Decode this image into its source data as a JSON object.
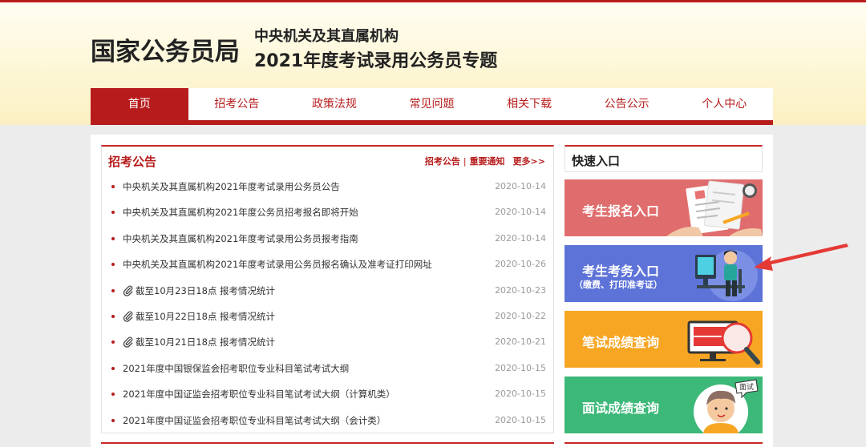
{
  "header": {
    "logo": "国家公务员局",
    "subtitle_line1": "中央机关及其直属机构",
    "subtitle_line2": "2021年度考试录用公务员专题"
  },
  "nav": {
    "items": [
      {
        "label": "首页",
        "active": true
      },
      {
        "label": "招考公告"
      },
      {
        "label": "政策法规"
      },
      {
        "label": "常见问题"
      },
      {
        "label": "相关下载"
      },
      {
        "label": "公告公示"
      },
      {
        "label": "个人中心"
      }
    ]
  },
  "notices": {
    "title": "招考公告",
    "link_notices": "招考公告",
    "separator": "|",
    "link_important": "重要通知",
    "link_more": "更多>>",
    "items": [
      {
        "text": "中央机关及其直属机构2021年度考试录用公务员公告",
        "date": "2020-10-14"
      },
      {
        "text": "中央机关及其直属机构2021年度公务员招考报名即将开始",
        "date": "2020-10-14"
      },
      {
        "text": "中央机关及其直属机构2021年度考试录用公务员报考指南",
        "date": "2020-10-14"
      },
      {
        "text": "中央机关及其直属机构2021年度考试录用公务员报名确认及准考证打印网址",
        "date": "2020-10-26"
      },
      {
        "text": "截至10月23日18点 报考情况统计",
        "date": "2020-10-23",
        "attachment": true
      },
      {
        "text": "截至10月22日18点 报考情况统计",
        "date": "2020-10-22",
        "attachment": true
      },
      {
        "text": "截至10月21日18点 报考情况统计",
        "date": "2020-10-21",
        "attachment": true
      },
      {
        "text": "2021年度中国银保监会招考职位专业科目笔试考试大纲",
        "date": "2020-10-15"
      },
      {
        "text": "2021年度中国证监会招考职位专业科目笔试考试大纲（计算机类）",
        "date": "2020-10-15"
      },
      {
        "text": "2021年度中国证监会招考职位专业科目笔试考试大纲（会计类）",
        "date": "2020-10-15"
      }
    ]
  },
  "quick": {
    "title": "快速入口",
    "register": "考生报名入口",
    "exam": "考生考务入口",
    "exam_sub": "（缴费、打印准考证）",
    "written": "笔试成绩查询",
    "interview": "面试成绩查询",
    "interview_badge": "面试"
  },
  "colors": {
    "brand_red": "#b71c1c",
    "register_bg": "#e06d6d",
    "exam_bg": "#5d73d8",
    "written_bg": "#f6a623",
    "interview_bg": "#3cb878"
  },
  "icons": [
    "attachment-icon",
    "bullet-dot-icon",
    "arrow-annotation-icon"
  ]
}
